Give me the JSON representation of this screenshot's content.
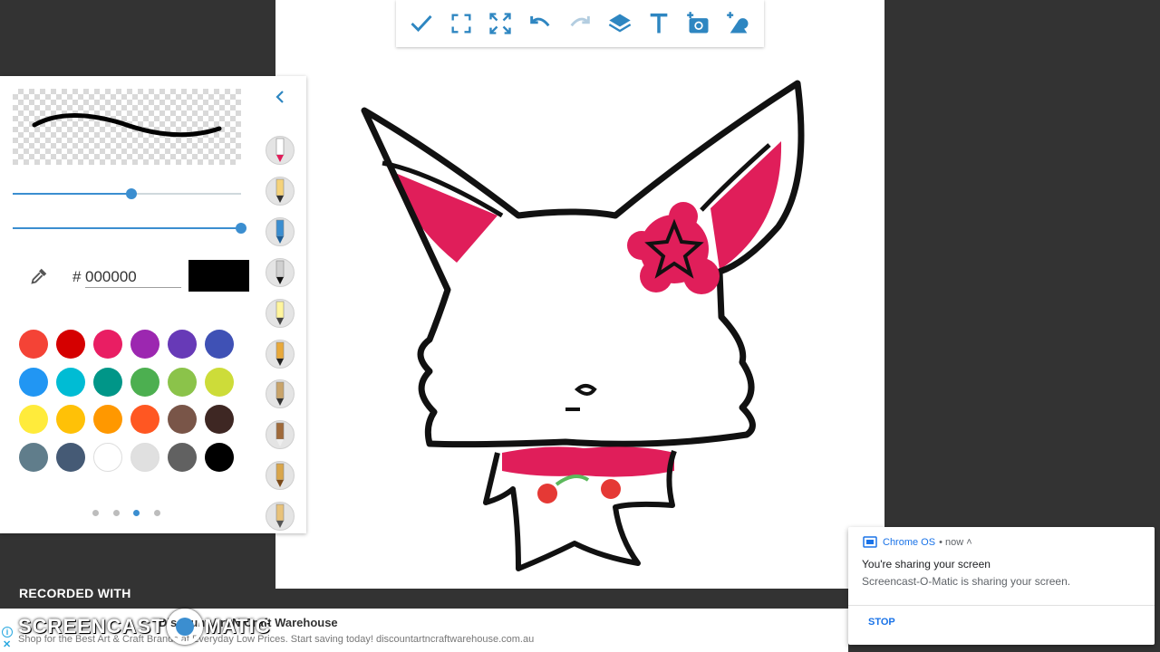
{
  "toolbar": {
    "buttons": [
      {
        "icon": "check-icon"
      },
      {
        "icon": "fit-screen-icon"
      },
      {
        "icon": "fullscreen-icon"
      },
      {
        "icon": "undo-icon"
      },
      {
        "icon": "redo-icon"
      },
      {
        "icon": "layers-icon"
      },
      {
        "icon": "text-icon"
      },
      {
        "icon": "add-photo-icon"
      },
      {
        "icon": "add-shape-icon"
      }
    ],
    "accent": "#2e86c1",
    "disabled": "#b3cde0"
  },
  "brush_panel": {
    "size_slider_value": 0.52,
    "opacity_slider_value": 1.0,
    "hash": "#",
    "hex_value": "000000",
    "current_color": "#000000",
    "swatches": [
      "#f44336",
      "#d50000",
      "#e91e63",
      "#9c27b0",
      "#673ab7",
      "#3f51b5",
      "#2196f3",
      "#00bcd4",
      "#009688",
      "#4caf50",
      "#8bc34a",
      "#cddc39",
      "#ffeb3b",
      "#ffc107",
      "#ff9800",
      "#ff5722",
      "#795548",
      "#3e2723",
      "#607d8b",
      "#455a75",
      "#ffffff",
      "#e0e0e0",
      "#616161",
      "#000000"
    ],
    "pager": {
      "count": 4,
      "active": 2
    },
    "tools": [
      "marker-icon",
      "pencil-icon",
      "pen-icon",
      "fineliner-icon",
      "calligraphy-icon",
      "highlighter-icon",
      "round-brush-icon",
      "flat-brush-icon",
      "fan-brush-icon",
      "eraser-icon"
    ]
  },
  "recorder": {
    "label": "RECORDED WITH",
    "logo_left": "SCREENCAST",
    "logo_right": "MATIC"
  },
  "ad": {
    "title": "Discount Art N Craft Warehouse",
    "text": "Shop for the Best Art & Craft Brands at Everyday Low Prices. Start saving today! discountartncraftwarehouse.com.au",
    "info": "i",
    "close": "✕"
  },
  "notification": {
    "app": "Chrome OS",
    "time": "• now ˄",
    "title": "You're sharing your screen",
    "body": "Screencast-O-Matic is sharing your screen.",
    "action": "STOP"
  }
}
